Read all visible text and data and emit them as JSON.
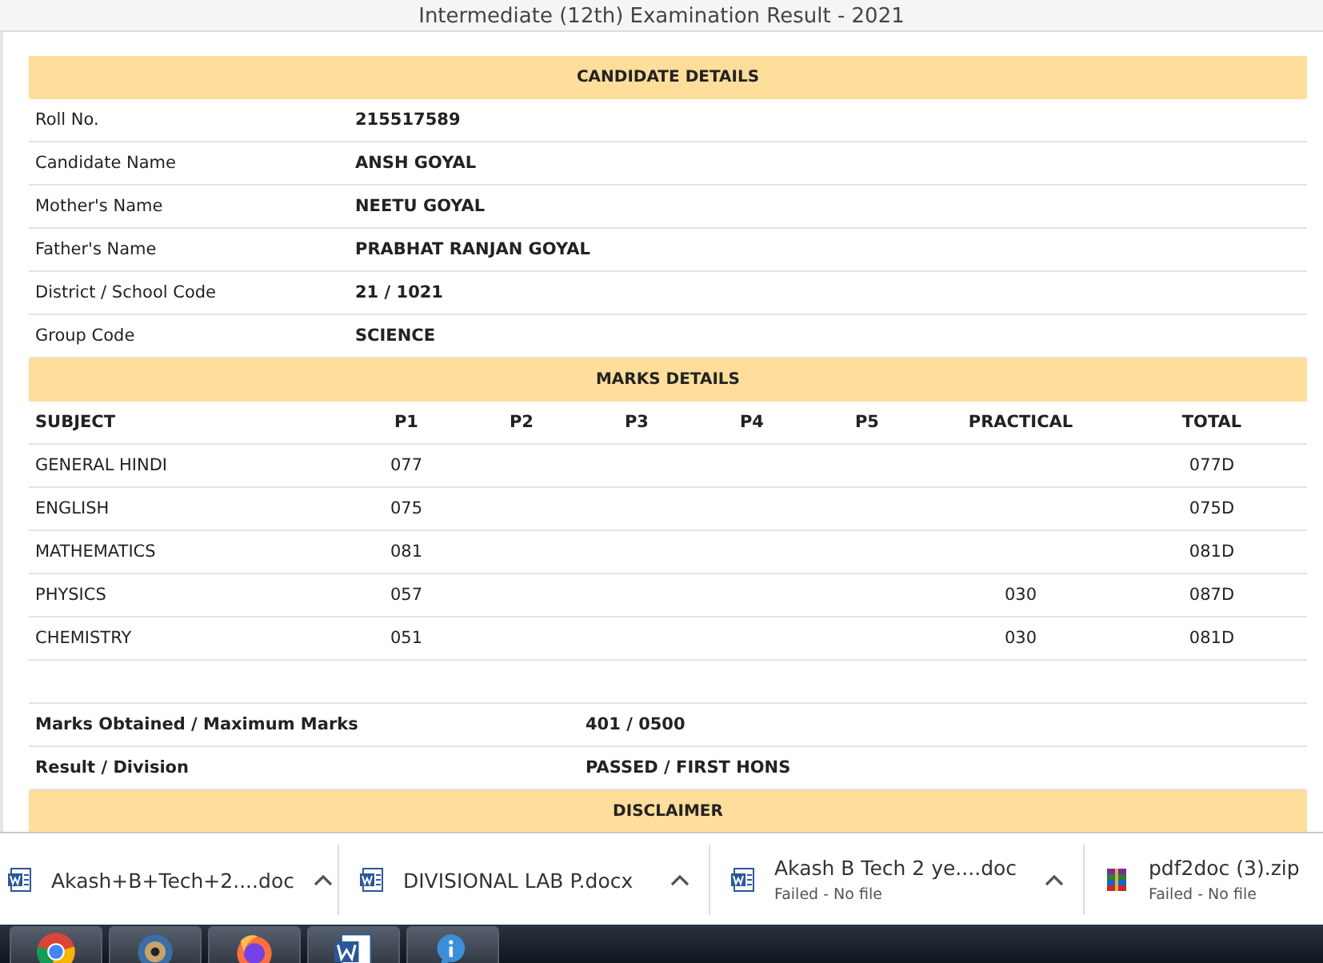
{
  "page_title": "Intermediate (12th) Examination Result - 2021",
  "candidate": {
    "heading": "CANDIDATE DETAILS",
    "rows": [
      {
        "label": "Roll No.",
        "value": "215517589"
      },
      {
        "label": "Candidate Name",
        "value": "ANSH GOYAL"
      },
      {
        "label": "Mother's Name",
        "value": "NEETU GOYAL"
      },
      {
        "label": "Father's Name",
        "value": "PRABHAT RANJAN GOYAL"
      },
      {
        "label": "District / School Code",
        "value": "21 / 1021"
      },
      {
        "label": "Group Code",
        "value": "SCIENCE"
      }
    ]
  },
  "marks": {
    "heading": "MARKS DETAILS",
    "columns": [
      "SUBJECT",
      "P1",
      "P2",
      "P3",
      "P4",
      "P5",
      "PRACTICAL",
      "TOTAL"
    ],
    "rows": [
      [
        "GENERAL HINDI",
        "077",
        "",
        "",
        "",
        "",
        "",
        "077D"
      ],
      [
        "ENGLISH",
        "075",
        "",
        "",
        "",
        "",
        "",
        "075D"
      ],
      [
        "MATHEMATICS",
        "081",
        "",
        "",
        "",
        "",
        "",
        "081D"
      ],
      [
        "PHYSICS",
        "057",
        "",
        "",
        "",
        "",
        "030",
        "087D"
      ],
      [
        "CHEMISTRY",
        "051",
        "",
        "",
        "",
        "",
        "030",
        "081D"
      ]
    ]
  },
  "summary": [
    {
      "label": "Marks Obtained / Maximum Marks",
      "value": "401 / 0500"
    },
    {
      "label": "Result / Division",
      "value": "PASSED / FIRST HONS"
    }
  ],
  "disclaimer": {
    "heading": "DISCLAIMER"
  },
  "downloads": [
    {
      "kind": "word",
      "name": "Akash+B+Tech+2....doc",
      "caret": true
    },
    {
      "kind": "word",
      "name": "DIVISIONAL LAB P.docx",
      "caret": true
    },
    {
      "kind": "word",
      "name": "Akash B Tech 2 ye....doc",
      "status": "Failed - No file",
      "caret": true
    },
    {
      "kind": "archive",
      "name": "pdf2doc (3).zip",
      "status": "Failed - No file",
      "caret": false
    }
  ],
  "taskbar": [
    {
      "kind": "chrome"
    },
    {
      "kind": "media"
    },
    {
      "kind": "firefox"
    },
    {
      "kind": "word"
    },
    {
      "kind": "info"
    }
  ]
}
